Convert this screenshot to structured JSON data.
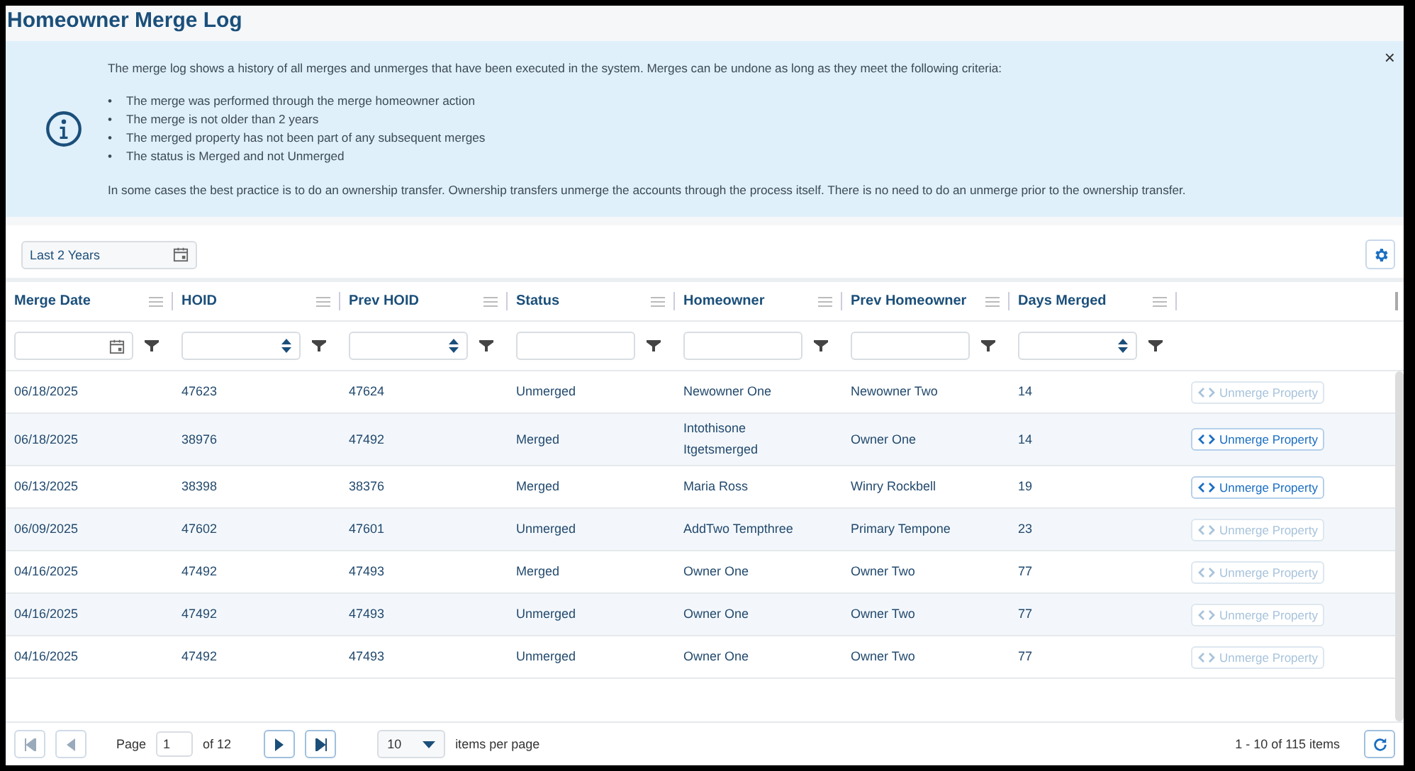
{
  "title": "Homeowner Merge Log",
  "info": {
    "intro": "The merge log shows a history of all merges and unmerges that have been executed in the system. Merges can be undone as long as they meet the following criteria:",
    "criteria": [
      {
        "bullet": "•",
        "text": "The merge was performed through the merge homeowner action"
      },
      {
        "bullet": "•",
        "text": "The merge is not older than 2 years"
      },
      {
        "bullet": "•",
        "text": "The merged property has not been part of any subsequent merges"
      },
      {
        "bullet": "•",
        "text": "The status is Merged and not Unmerged"
      }
    ],
    "note": "In some cases the best practice is to do an ownership transfer. Ownership transfers unmerge the accounts through the process itself. There is no need to do an unmerge prior to the ownership transfer.",
    "close": "×"
  },
  "range_picker": {
    "value": "Last 2 Years"
  },
  "columns": [
    {
      "label": "Merge Date",
      "kind": "date"
    },
    {
      "label": "HOID",
      "kind": "numeric"
    },
    {
      "label": "Prev HOID",
      "kind": "numeric"
    },
    {
      "label": "Status",
      "kind": "text"
    },
    {
      "label": "Homeowner",
      "kind": "text"
    },
    {
      "label": "Prev Homeowner",
      "kind": "text"
    },
    {
      "label": "Days Merged",
      "kind": "numeric"
    }
  ],
  "rows": [
    {
      "cells": [
        "06/18/2025",
        "47623",
        "47624",
        "Unmerged",
        "Newowner One",
        "Newowner Two",
        "14"
      ],
      "action": {
        "label": "Unmerge Property",
        "disabled": true
      }
    },
    {
      "cells": [
        "06/18/2025",
        "38976",
        "47492",
        "Merged",
        "Intothisone Itgetsmerged",
        "Owner One",
        "14"
      ],
      "action": {
        "label": "Unmerge Property",
        "disabled": false
      }
    },
    {
      "cells": [
        "06/13/2025",
        "38398",
        "38376",
        "Merged",
        "Maria Ross",
        "Winry Rockbell",
        "19"
      ],
      "action": {
        "label": "Unmerge Property",
        "disabled": false
      }
    },
    {
      "cells": [
        "06/09/2025",
        "47602",
        "47601",
        "Unmerged",
        "AddTwo Tempthree",
        "Primary Tempone",
        "23"
      ],
      "action": {
        "label": "Unmerge Property",
        "disabled": true
      }
    },
    {
      "cells": [
        "04/16/2025",
        "47492",
        "47493",
        "Merged",
        "Owner One",
        "Owner Two",
        "77"
      ],
      "action": {
        "label": "Unmerge Property",
        "disabled": true
      }
    },
    {
      "cells": [
        "04/16/2025",
        "47492",
        "47493",
        "Unmerged",
        "Owner One",
        "Owner Two",
        "77"
      ],
      "action": {
        "label": "Unmerge Property",
        "disabled": true
      }
    },
    {
      "cells": [
        "04/16/2025",
        "47492",
        "47493",
        "Unmerged",
        "Owner One",
        "Owner Two",
        "77"
      ],
      "action": {
        "label": "Unmerge Property",
        "disabled": true
      }
    }
  ],
  "pager": {
    "page_label": "Page",
    "page": "1",
    "of": "of 12",
    "page_size": "10",
    "per_page": "items per page",
    "summary": "1 - 10 of 115 items"
  }
}
